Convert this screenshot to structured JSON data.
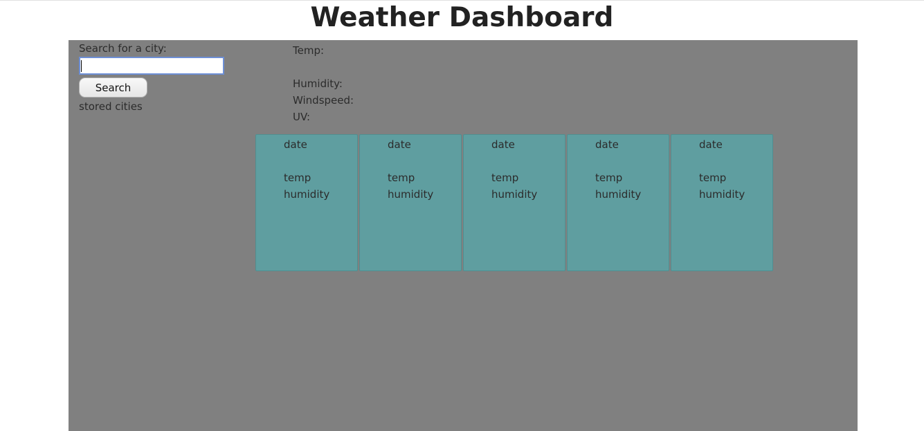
{
  "header": {
    "title": "Weather Dashboard"
  },
  "search": {
    "label": "Search for a city:",
    "value": "",
    "placeholder": "",
    "button_label": "Search",
    "stored_cities_label": "stored cities"
  },
  "current": {
    "temp_label": "Temp:",
    "humidity_label": "Humidity:",
    "windspeed_label": "Windspeed:",
    "uv_label": "UV:"
  },
  "forecast": {
    "cards": [
      {
        "date": "date",
        "temp": "temp",
        "humidity": "humidity"
      },
      {
        "date": "date",
        "temp": "temp",
        "humidity": "humidity"
      },
      {
        "date": "date",
        "temp": "temp",
        "humidity": "humidity"
      },
      {
        "date": "date",
        "temp": "temp",
        "humidity": "humidity"
      },
      {
        "date": "date",
        "temp": "temp",
        "humidity": "humidity"
      }
    ]
  },
  "colors": {
    "panel_background": "#808080",
    "card_background": "#5f9ea0",
    "input_focus_border": "#6d8fd6"
  }
}
